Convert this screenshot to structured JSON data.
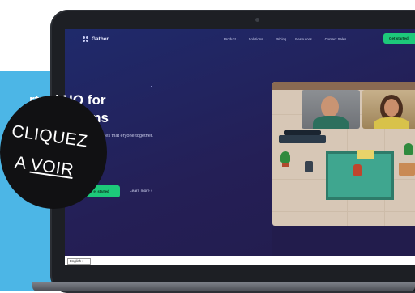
{
  "nav": {
    "logo_text": "Gather",
    "links": [
      "Product ⌄",
      "Solutions ⌄",
      "Pricing",
      "Resources ⌄",
      "Contact Sales"
    ],
    "cta_label": "Get started"
  },
  "hero": {
    "title_line1": "rtual HQ for",
    "title_line2": "mote Teams",
    "subtitle": "lps distributed teams build digital spaces that eryone together.",
    "primary_button": "et started",
    "learn_more": "Learn more  ›"
  },
  "footer": {
    "language": "English  ›"
  },
  "badge": {
    "line1": "CLIQUEZ",
    "line2_prefix": "A ",
    "line2_link": "VOIR"
  },
  "icons": {
    "logo": "gather-logo-icon",
    "game": "pixel-office-illustration"
  },
  "colors": {
    "accent_green": "#1dc97a",
    "hero_bg": "#241f56",
    "backdrop_blue": "#4cb6e6",
    "badge_black": "#111113"
  }
}
